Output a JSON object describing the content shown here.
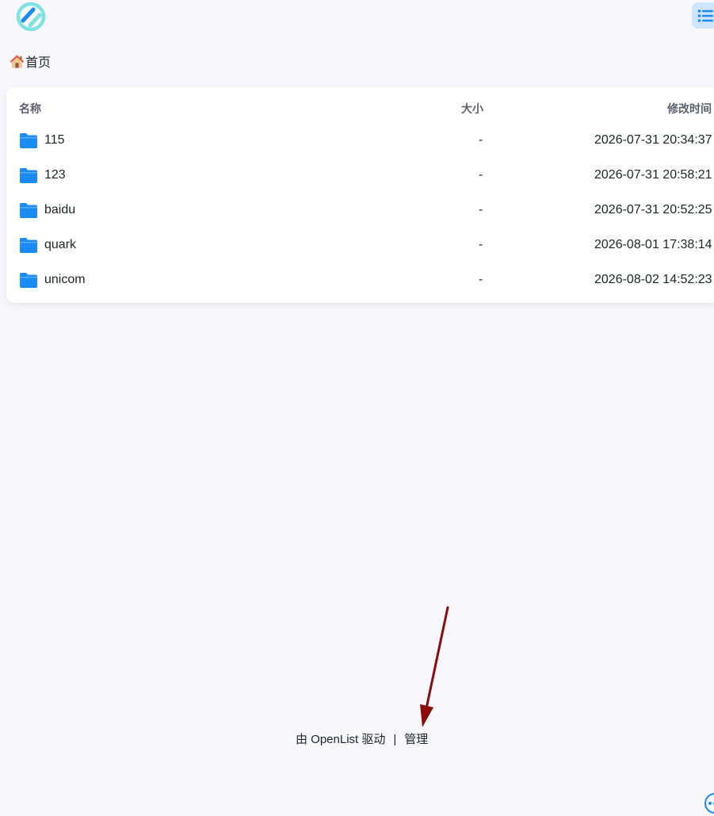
{
  "header": {
    "logo_icon": "openlist-logo-icon",
    "view_toggle_icon": "list-view-icon",
    "accent_color": "#1a8bf5"
  },
  "breadcrumb": {
    "home_icon": "house-icon",
    "home_label": "首页"
  },
  "table": {
    "columns": {
      "name": "名称",
      "size": "大小",
      "modified": "修改时间"
    },
    "rows": [
      {
        "icon": "folder-icon",
        "name": "115",
        "size": "-",
        "modified": "2026-07-31 20:34:37"
      },
      {
        "icon": "folder-icon",
        "name": "123",
        "size": "-",
        "modified": "2026-07-31 20:58:21"
      },
      {
        "icon": "folder-icon",
        "name": "baidu",
        "size": "-",
        "modified": "2026-07-31 20:52:25"
      },
      {
        "icon": "folder-icon",
        "name": "quark",
        "size": "-",
        "modified": "2026-08-01 17:38:14"
      },
      {
        "icon": "folder-icon",
        "name": "unicom",
        "size": "-",
        "modified": "2026-08-02 14:52:23"
      }
    ]
  },
  "footer": {
    "powered_by": "由 OpenList 驱动",
    "separator": "|",
    "manage_label": "管理"
  },
  "annotation": {
    "arrow_color": "#8b0a0a"
  }
}
